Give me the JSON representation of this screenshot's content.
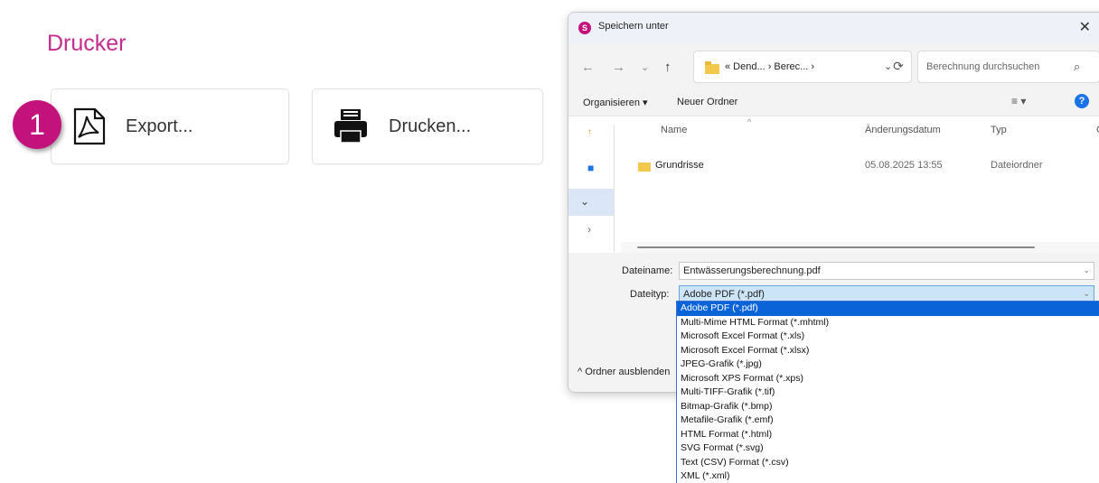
{
  "page": {
    "title": "Drucker",
    "badge_number": "1",
    "export_label": "Export...",
    "print_label": "Drucken..."
  },
  "dialog": {
    "title": "Speichern unter",
    "app_icon_letter": "S",
    "close_symbol": "✕",
    "address_path": "« Dend... › Berec... ›",
    "search_placeholder": "Berechnung durchsuchen",
    "organize_label": "Organisieren ▾",
    "new_folder_label": "Neuer Ordner",
    "help_symbol": "?",
    "columns": {
      "name": "Name",
      "date": "Änderungsdatum",
      "type": "Typ",
      "size": "G"
    },
    "rows": [
      {
        "name": "Grundrisse",
        "date": "05.08.2025 13:55",
        "type": "Dateiordner"
      }
    ],
    "filename_label": "Dateiname:",
    "filename_value": "Entwässerungsberechnung.pdf",
    "filetype_label": "Dateityp:",
    "filetype_value": "Adobe PDF (*.pdf)",
    "hide_folders_label": "^ Ordner ausblenden"
  },
  "filetype_options": [
    "Adobe PDF (*.pdf)",
    "Multi-Mime HTML Format (*.mhtml)",
    "Microsoft Excel Format (*.xls)",
    "Microsoft Excel Format (*.xlsx)",
    "JPEG-Grafik (*.jpg)",
    "Microsoft XPS Format (*.xps)",
    "Multi-TIFF-Grafik (*.tif)",
    "Bitmap-Grafik (*.bmp)",
    "Metafile-Grafik (*.emf)",
    "HTML Format (*.html)",
    "SVG Format (*.svg)",
    "Text (CSV) Format (*.csv)",
    "XML (*.xml)"
  ],
  "colors": {
    "accent": "#c42d8f",
    "badge": "#c4127d",
    "selection": "#0a64d8",
    "folder": "#f2c94c"
  },
  "icons": [
    "pdf-icon",
    "printer-icon",
    "back-arrow-icon",
    "forward-arrow-icon",
    "up-arrow-icon",
    "refresh-icon",
    "search-icon",
    "view-icon",
    "help-icon",
    "folder-icon",
    "close-icon"
  ]
}
